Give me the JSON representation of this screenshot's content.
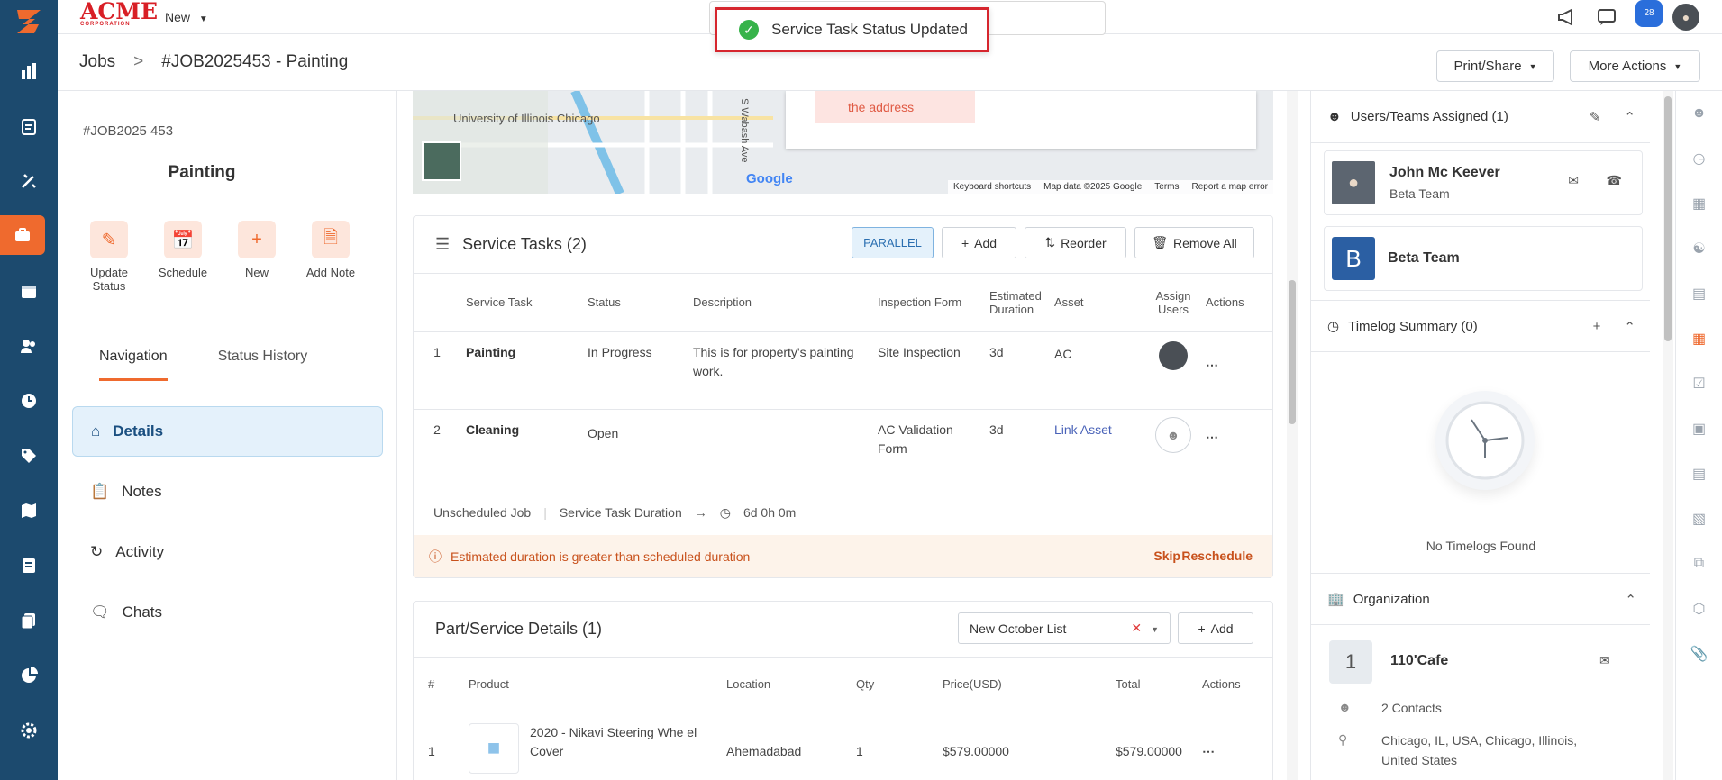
{
  "app": {
    "brand_main": "ACME",
    "brand_sub": "CORPORATION",
    "new_menu": "New",
    "notification_count": "28",
    "accent_color": "#ef6a2e",
    "sidebar_color": "#1c4a6e"
  },
  "toast": {
    "message": "Service Task Status Updated"
  },
  "breadcrumb": {
    "root": "Jobs",
    "separator": ">",
    "current": "#JOB2025453 - Painting"
  },
  "header_buttons": {
    "print_share": "Print/Share",
    "more_actions": "More Actions"
  },
  "job": {
    "number": "#JOB2025 453",
    "title": "Painting",
    "actions": [
      {
        "label": "Update Status",
        "icon": "pencil-icon"
      },
      {
        "label": "Schedule",
        "icon": "calendar-clock-icon"
      },
      {
        "label": "New",
        "icon": "plus-icon"
      },
      {
        "label": "Add Note",
        "icon": "note-add-icon"
      }
    ],
    "tabs": [
      "Navigation",
      "Status History"
    ],
    "nav_items": [
      {
        "label": "Details",
        "icon": "home-icon",
        "active": true
      },
      {
        "label": "Notes",
        "icon": "clipboard-icon"
      },
      {
        "label": "Activity",
        "icon": "history-icon"
      },
      {
        "label": "Chats",
        "icon": "chat-icon"
      }
    ]
  },
  "map": {
    "address_warning": "the address",
    "labels": [
      "University of Illinois Chicago",
      "S Wabash Ave",
      "Google"
    ],
    "footer": [
      "Keyboard shortcuts",
      "Map data ©2025 Google",
      "Terms",
      "Report a map error"
    ]
  },
  "service_tasks": {
    "title": "Service Tasks (2)",
    "mode": "PARALLEL",
    "add": "Add",
    "reorder": "Reorder",
    "remove_all": "Remove All",
    "columns": [
      "Service Task",
      "Status",
      "Description",
      "Inspection Form",
      "Estimated Duration",
      "Asset",
      "Assign Users",
      "Actions"
    ],
    "rows": [
      {
        "num": "1",
        "task": "Painting",
        "status": "In Progress",
        "description": "This is for property's painting work.",
        "form": "Site Inspection",
        "duration": "3d",
        "asset": "AC",
        "assigned": true
      },
      {
        "num": "2",
        "task": "Cleaning",
        "status": "Open",
        "description": "",
        "form": "AC Validation Form",
        "duration": "3d",
        "asset": "Link Asset",
        "assigned": false
      }
    ],
    "footer_job": "Unscheduled Job",
    "footer_duration_label": "Service Task Duration",
    "footer_duration_value": "6d 0h 0m",
    "warning": "Estimated duration is greater than scheduled duration",
    "skip": "Skip",
    "reschedule": "Reschedule"
  },
  "parts": {
    "title": "Part/Service Details (1)",
    "price_list": "New October List",
    "add": "Add",
    "columns": [
      "#",
      "Product",
      "Location",
      "Qty",
      "Price(USD)",
      "Total",
      "Actions"
    ],
    "rows": [
      {
        "num": "1",
        "product": "2020 - Nikavi Steering Whe el Cover",
        "location": "Ahemadabad",
        "qty": "1",
        "price": "$579.00000",
        "total": "$579.00000"
      }
    ]
  },
  "right_panel": {
    "users_title": "Users/Teams Assigned (1)",
    "user_name": "John Mc Keever",
    "user_team": "Beta Team",
    "team_letter": "B",
    "team_name": "Beta Team",
    "timelog_title": "Timelog Summary (0)",
    "no_timelogs": "No Timelogs Found",
    "org_title": "Organization",
    "org_letter": "1",
    "org_name": "110'Cafe",
    "org_contacts": "2 Contacts",
    "org_address": "Chicago, IL, USA, Chicago, Illinois, United States"
  }
}
